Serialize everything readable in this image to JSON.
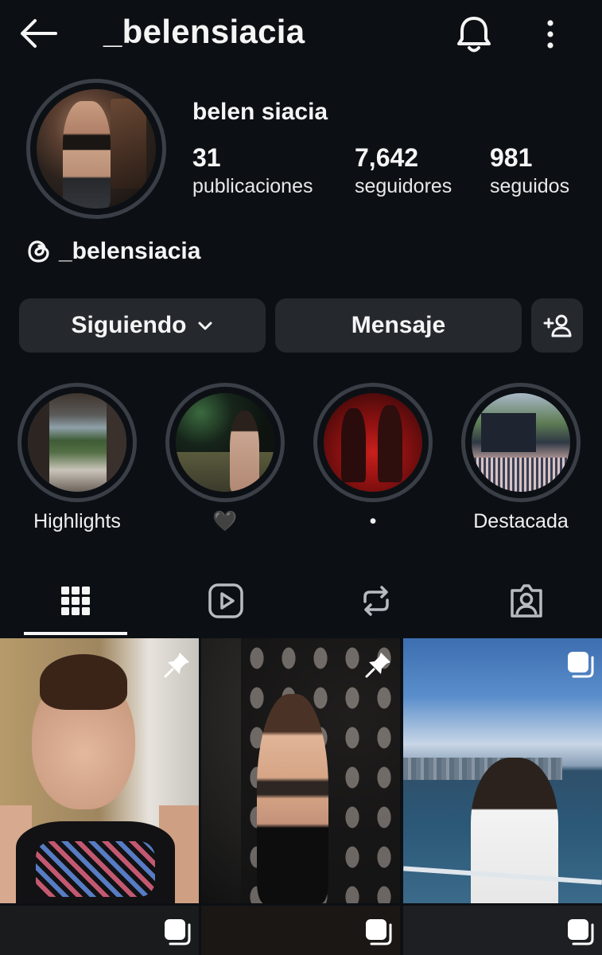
{
  "header": {
    "title": "_belensiacia",
    "back_icon": "arrow-left-icon",
    "bell_icon": "bell-icon",
    "more_icon": "more-vertical-icon"
  },
  "profile": {
    "display_name": "belen siacia",
    "stats": {
      "posts": {
        "value": "31",
        "label": "publicaciones"
      },
      "followers": {
        "value": "7,642",
        "label": "seguidores"
      },
      "following": {
        "value": "981",
        "label": "seguidos"
      }
    },
    "threads_handle": "_belensiacia"
  },
  "actions": {
    "following_label": "Siguiendo",
    "message_label": "Mensaje",
    "suggest_icon": "add-person-icon"
  },
  "highlights": [
    {
      "label": "Highlights"
    },
    {
      "label": "🖤"
    },
    {
      "label": "•"
    },
    {
      "label": "Destacada"
    }
  ],
  "tabs": [
    {
      "name": "posts",
      "icon": "grid-icon",
      "active": true
    },
    {
      "name": "reels",
      "icon": "reels-icon",
      "active": false
    },
    {
      "name": "reposts",
      "icon": "repost-icon",
      "active": false
    },
    {
      "name": "tagged",
      "icon": "tagged-icon",
      "active": false
    }
  ],
  "posts": [
    {
      "badge": "pin-icon"
    },
    {
      "badge": "pin-icon"
    },
    {
      "badge": "carousel-icon"
    },
    {
      "badge": "carousel-icon"
    },
    {
      "badge": "carousel-icon"
    },
    {
      "badge": "carousel-icon"
    }
  ],
  "colors": {
    "background": "#0c1014",
    "button": "#25292e",
    "ring": "#3a3f47",
    "text": "#f5f5f5"
  }
}
